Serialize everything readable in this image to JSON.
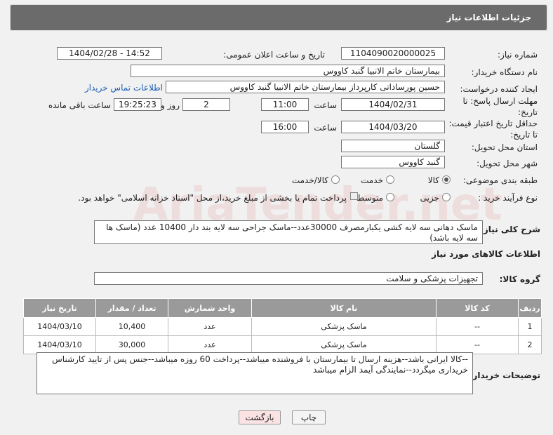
{
  "header": {
    "title": "جزئیات اطلاعات نیاز"
  },
  "form": {
    "need_number_label": "شماره نیاز:",
    "need_number": "1104090020000025",
    "announce_label": "تاریخ و ساعت اعلان عمومی:",
    "announce_value": "1404/02/28 - 14:52",
    "buyer_org_label": "نام دستگاه خریدار:",
    "buyer_org": "بیمارستان خاتم الانبیا گنبد کاووس",
    "creator_label": "ایجاد کننده درخواست:",
    "creator": "حسین پورساداتی کارپرداز بیمارستان خاتم الانبیا گنبد کاووس",
    "contact_link": "اطلاعات تماس خریدار",
    "send_deadline_label_1": "مهلت ارسال پاسخ: تا",
    "send_deadline_label_2": "تاریخ:",
    "send_date": "1404/02/31",
    "time_label": "ساعت",
    "send_time": "11:00",
    "days": "2",
    "days_label": "روز و",
    "remaining_time": "19:25:23",
    "remaining_label": "ساعت باقی مانده",
    "price_deadline_label_1": "حداقل تاریخ اعتبار قیمت:",
    "price_deadline_label_2": "تا تاریخ:",
    "price_date": "1404/03/20",
    "price_time": "16:00",
    "province_label": "استان محل تحویل:",
    "province": "گلستان",
    "city_label": "شهر محل تحویل:",
    "city": "گنبد کاووس",
    "category_label": "طبقه بندی موضوعی:",
    "category_options": [
      "کالا",
      "خدمت",
      "کالا/خدمت"
    ],
    "process_label": "نوع فرآیند خرید :",
    "process_options": [
      "جزیی",
      "متوسط"
    ],
    "payment_note": "پرداخت تمام یا بخشی از مبلغ خرید،از محل \"اسناد خزانه اسلامی\" خواهد بود.",
    "description_label": "شرح کلی نیاز:",
    "description": "ماسک دهانی سه لایه کشی یکبارمصرف 30000عدد--ماسک جراحی سه لایه بند دار 10400 عدد (ماسک ها سه لایه باشد)",
    "goods_info_title": "اطلاعات کالاهای مورد نیاز",
    "goods_group_label": "گروه کالا:",
    "goods_group": "تجهیزات پزشکی و سلامت"
  },
  "table": {
    "headers": [
      "ردیف",
      "کد کالا",
      "نام کالا",
      "واحد شمارش",
      "تعداد / مقدار",
      "تاریخ نیاز"
    ],
    "rows": [
      [
        "1",
        "--",
        "ماسک پزشکی",
        "عدد",
        "10,400",
        "1404/03/10"
      ],
      [
        "2",
        "--",
        "ماسک پزشکی",
        "عدد",
        "30,000",
        "1404/03/10"
      ]
    ]
  },
  "buyer_notes_label": "توضیحات خریدار:",
  "buyer_notes": "--کالا ایرانی باشد--هزینه ارسال تا بیمارستان با فروشنده میباشد--پرداخت 60 روزه میباشد--جنس پس از تایید کارشناس خریداری میگردد--نمایندگی آیمد الزام میباشد",
  "buttons": {
    "print": "چاپ",
    "back": "بازگشت"
  },
  "watermark": "AriaTender.net"
}
